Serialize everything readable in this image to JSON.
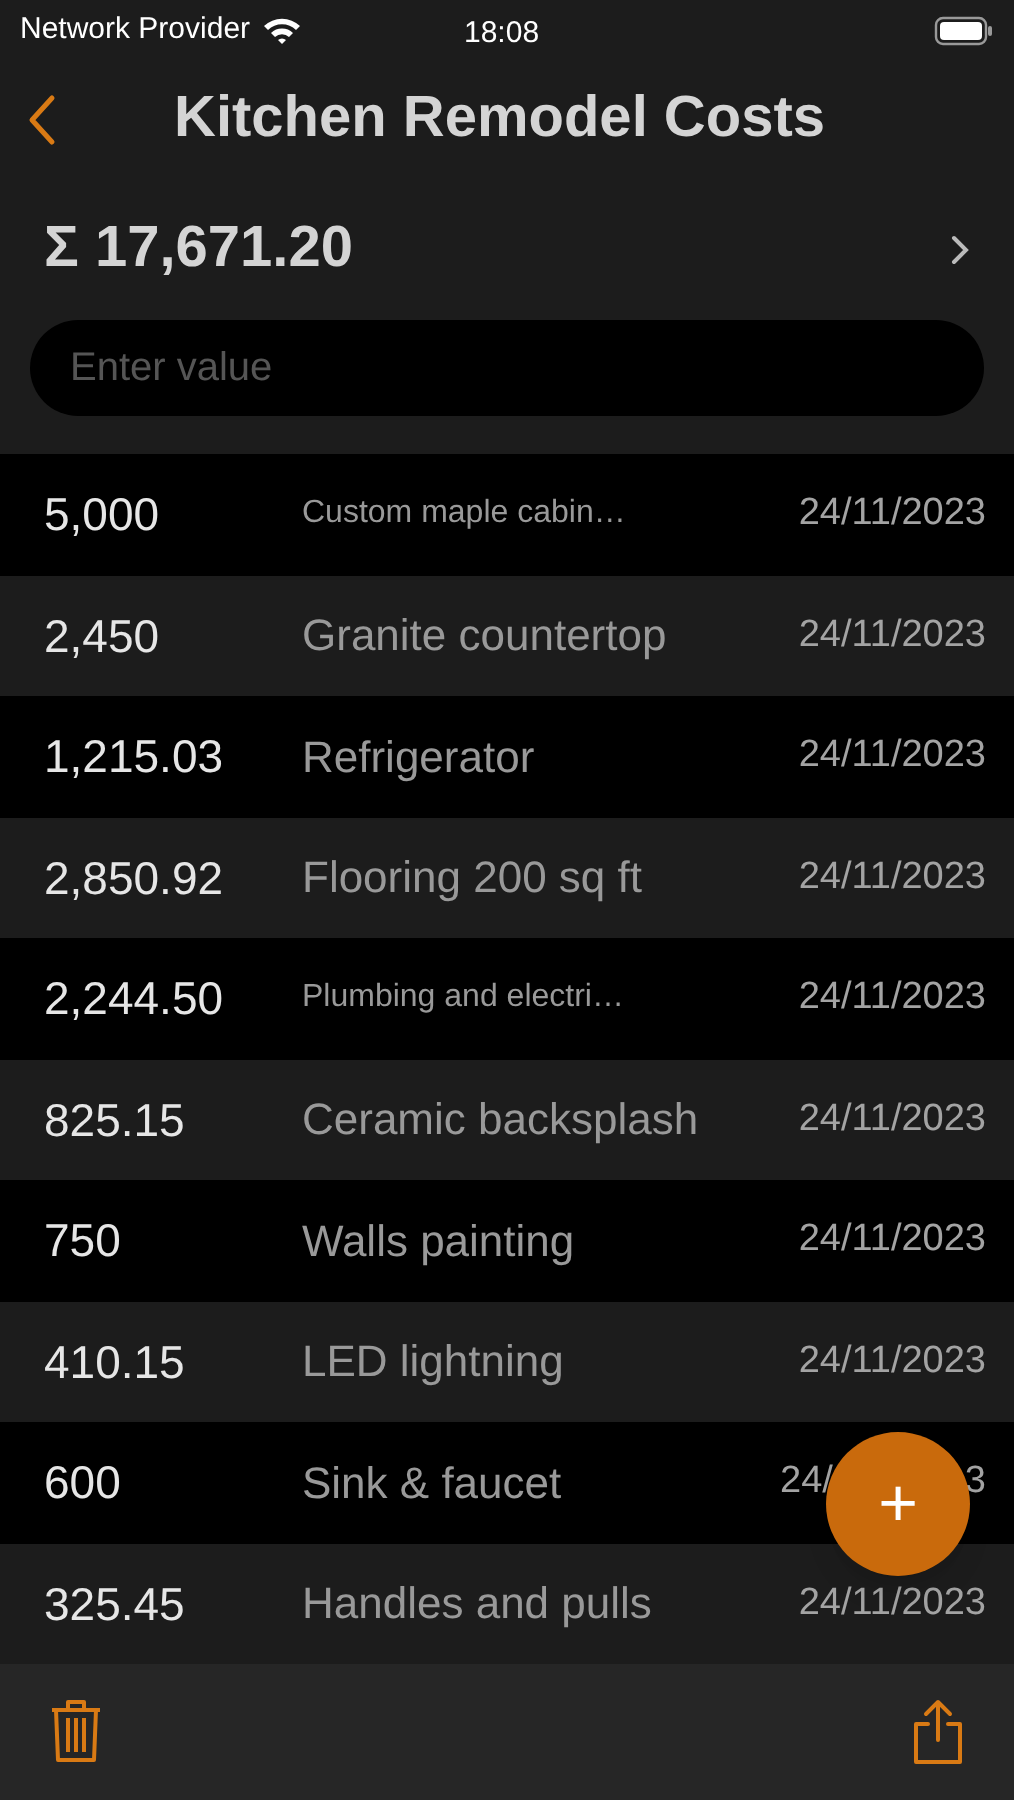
{
  "status_bar": {
    "carrier": "Network Provider",
    "time": "18:08"
  },
  "nav": {
    "title": "Kitchen Remodel Costs"
  },
  "total": "Σ 17,671.20",
  "input": {
    "placeholder": "Enter value"
  },
  "entries": [
    {
      "amount": "5,000",
      "description": "Custom maple cabin…",
      "date": "24/11/2023"
    },
    {
      "amount": "2,450",
      "description": "Granite countertop",
      "date": "24/11/2023"
    },
    {
      "amount": "1,215.03",
      "description": "Refrigerator",
      "date": "24/11/2023"
    },
    {
      "amount": "2,850.92",
      "description": "Flooring 200 sq ft",
      "date": "24/11/2023"
    },
    {
      "amount": "2,244.50",
      "description": "Plumbing and electri…",
      "date": "24/11/2023"
    },
    {
      "amount": "825.15",
      "description": "Ceramic backsplash",
      "date": "24/11/2023"
    },
    {
      "amount": "750",
      "description": "Walls painting",
      "date": "24/11/2023"
    },
    {
      "amount": "410.15",
      "description": "LED lightning",
      "date": "24/11/2023"
    },
    {
      "amount": "600",
      "description": "Sink & faucet",
      "date_fragments": [
        "24/",
        "3"
      ]
    },
    {
      "amount": "325.45",
      "description": "Handles and pulls",
      "date": "24/11/2023"
    }
  ],
  "fab": {
    "label": "+"
  }
}
